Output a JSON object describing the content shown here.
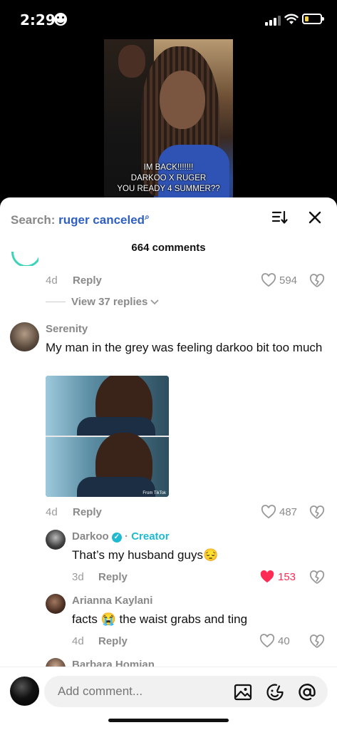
{
  "status_bar": {
    "time": "2:29"
  },
  "video": {
    "caption_lines": [
      "IM BACK!!!!!!!",
      "DARKOO X RUGER",
      "YOU READY 4 SUMMER??"
    ]
  },
  "header": {
    "search_label": "Search:",
    "search_query": "ruger canceled",
    "comment_count_label": "664 comments"
  },
  "comments": [
    {
      "age": "4d",
      "reply_label": "Reply",
      "likes": "594",
      "view_replies_label": "View 37 replies"
    },
    {
      "username": "Serenity",
      "text": "My man in the grey was feeling darkoo bit too much",
      "image_watermark": "From TikTok",
      "age": "4d",
      "reply_label": "Reply",
      "likes": "487",
      "replies": [
        {
          "username": "Darkoo",
          "badge": "Creator",
          "text": "That’s my husband guys😔",
          "age": "3d",
          "reply_label": "Reply",
          "likes": "153",
          "liked": true
        },
        {
          "username": "Arianna Kaylani",
          "text": "facts 😭 the waist grabs and ting",
          "age": "4d",
          "reply_label": "Reply",
          "likes": "40"
        },
        {
          "username": "Barbara Homian"
        }
      ]
    }
  ],
  "composer": {
    "placeholder": "Add comment..."
  },
  "colors": {
    "accent_blue": "#2f5fbf",
    "creator_teal": "#20b9d2",
    "like_red": "#fe2c55"
  }
}
